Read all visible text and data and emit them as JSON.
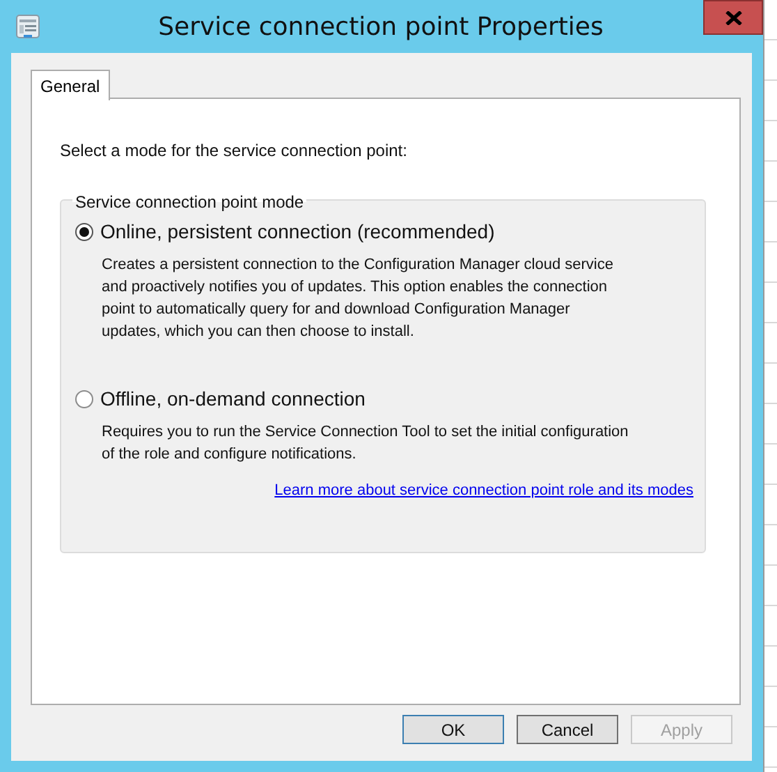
{
  "window": {
    "title": "Service connection point Properties"
  },
  "tabs": [
    {
      "label": "General",
      "selected": true
    }
  ],
  "instruction": "Select a mode for the service connection point:",
  "group": {
    "title": "Service connection point mode",
    "options": [
      {
        "label": "Online, persistent connection (recommended)",
        "selected": true,
        "description": "Creates a persistent connection to the Configuration Manager cloud service and proactively notifies you of updates. This option enables the connection point to automatically query for and download Configuration Manager updates, which you can then choose to install."
      },
      {
        "label": "Offline, on-demand connection",
        "selected": false,
        "description": "Requires you to run the Service Connection Tool to set the initial configuration of the role and configure notifications."
      }
    ],
    "link": "Learn more about service connection point role and its modes"
  },
  "buttons": [
    {
      "label": "OK",
      "default": true,
      "disabled": false
    },
    {
      "label": "Cancel",
      "default": false,
      "disabled": false
    },
    {
      "label": "Apply",
      "default": false,
      "disabled": true
    }
  ]
}
